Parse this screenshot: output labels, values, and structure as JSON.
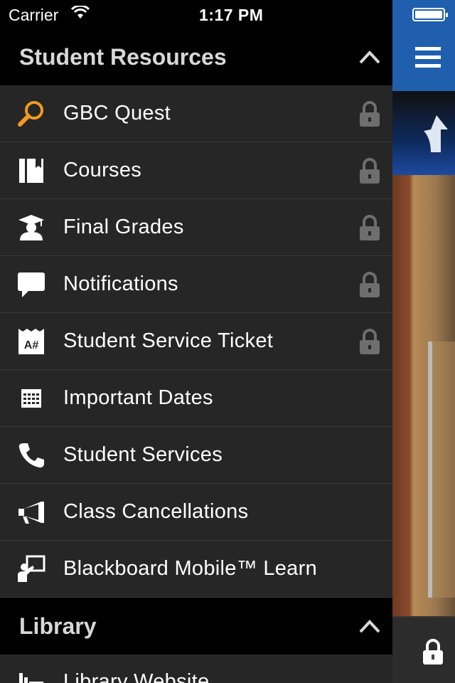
{
  "status_bar": {
    "carrier": "Carrier",
    "time": "1:17 PM"
  },
  "sections": [
    {
      "title": "Student Resources",
      "expanded": true,
      "items": [
        {
          "label": "GBC Quest",
          "icon": "search-icon",
          "locked": true
        },
        {
          "label": "Courses",
          "icon": "book-icon",
          "locked": true
        },
        {
          "label": "Final Grades",
          "icon": "graduate-icon",
          "locked": true
        },
        {
          "label": "Notifications",
          "icon": "speech-bubble-icon",
          "locked": true
        },
        {
          "label": "Student Service Ticket",
          "icon": "ticket-icon",
          "locked": true
        },
        {
          "label": "Important Dates",
          "icon": "calendar-icon",
          "locked": false
        },
        {
          "label": "Student Services",
          "icon": "phone-icon",
          "locked": false
        },
        {
          "label": "Class Cancellations",
          "icon": "megaphone-icon",
          "locked": false
        },
        {
          "label": "Blackboard Mobile™ Learn",
          "icon": "presenter-icon",
          "locked": false
        }
      ]
    },
    {
      "title": "Library",
      "expanded": true,
      "items": [
        {
          "label": "Library Website",
          "icon": "library-icon",
          "locked": false
        }
      ]
    }
  ],
  "colors": {
    "drawer_bg": "#262626",
    "header_bg": "#000000",
    "accent_orange": "#f39a1e",
    "topbar_blue": "#1f5fae"
  }
}
